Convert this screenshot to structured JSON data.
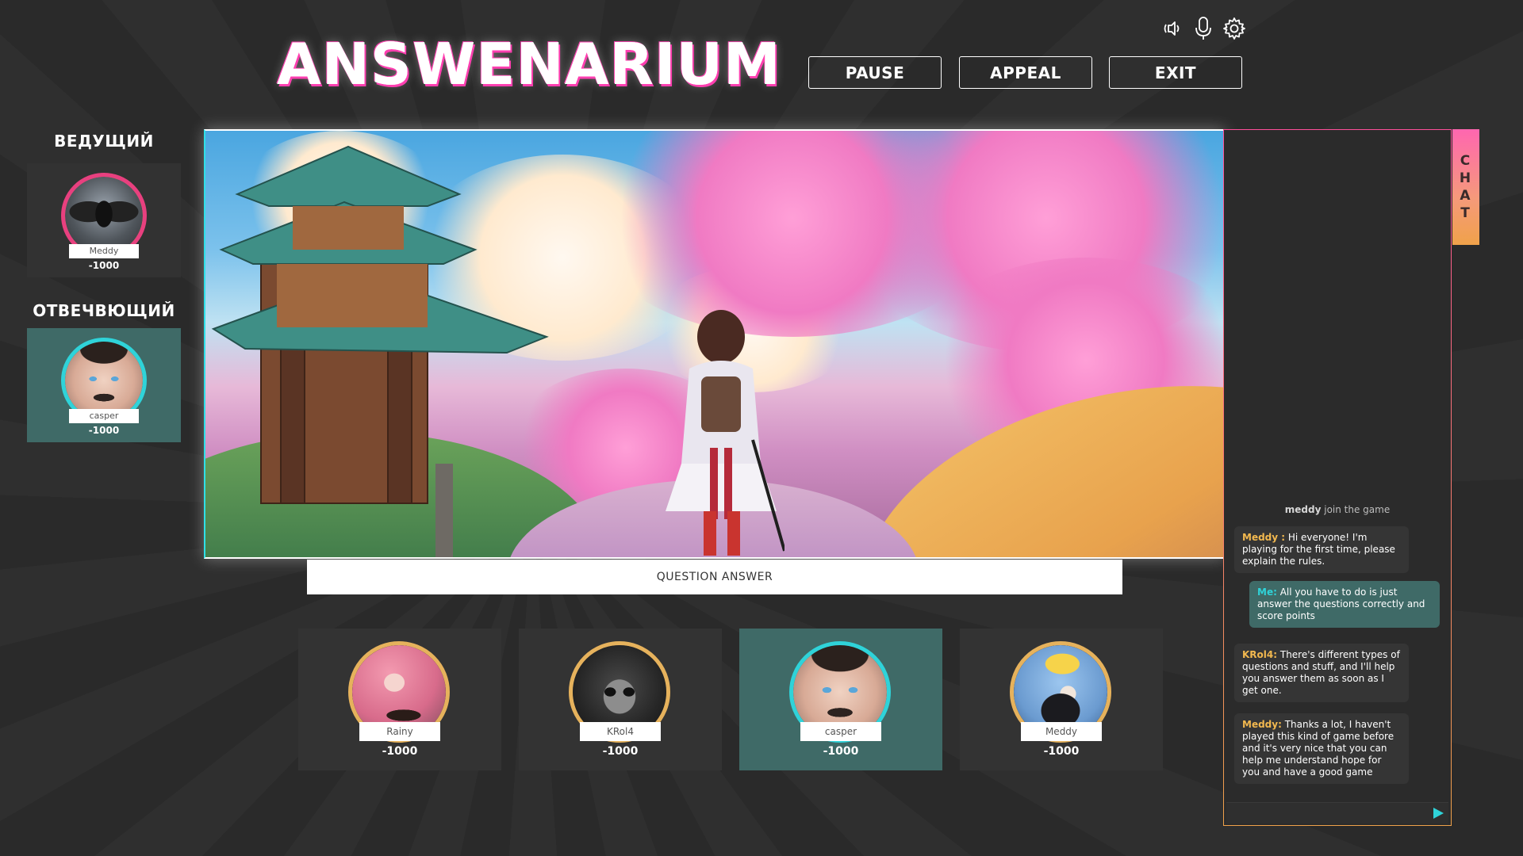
{
  "app": {
    "logo_text": "ANSWENARIUM"
  },
  "top_icons": [
    {
      "name": "volume-icon"
    },
    {
      "name": "microphone-icon"
    },
    {
      "name": "gear-icon"
    }
  ],
  "toolbar": {
    "pause_label": "PAUSE",
    "appeal_label": "APPEAL",
    "exit_label": "EXIT"
  },
  "roles": {
    "host_title": "ВЕДУЩИЙ",
    "host": {
      "name": "Meddy",
      "score": "-1000"
    },
    "answerer_title": "ОТВЕЧВЮЩИЙ",
    "answerer": {
      "name": "casper",
      "score": "-1000"
    }
  },
  "question": {
    "caption": "QUESTION ANSWER"
  },
  "players": [
    {
      "name": "Rainy",
      "score": "-1000",
      "active": false
    },
    {
      "name": "KRol4",
      "score": "-1000",
      "active": false
    },
    {
      "name": "casper",
      "score": "-1000",
      "active": true
    },
    {
      "name": "Meddy",
      "score": "-1000",
      "active": false
    }
  ],
  "chat": {
    "tab_letters": [
      "C",
      "H",
      "A",
      "T"
    ],
    "system_message": {
      "user": "meddy",
      "text": " join the game"
    },
    "messages": [
      {
        "author": "Meddy :",
        "text": " Hi everyone! I'm playing for the first time, please explain the rules.",
        "self": false
      },
      {
        "author": "Me:",
        "text": " All you have to do is just answer the questions correctly and score points",
        "self": true
      },
      {
        "author": "KRol4:",
        "text": " There's different types of questions and stuff, and I'll help you answer them as soon as I get one.",
        "self": false
      },
      {
        "author": "Meddy:",
        "text": " Thanks a lot, I haven't played this kind of game before and it's very nice that you can help me understand hope for you and have a good game",
        "self": false
      }
    ],
    "input_value": "",
    "input_placeholder": ""
  },
  "colors": {
    "accent_teal": "#2fd3d9",
    "accent_pink": "#ff4f9a",
    "accent_gold": "#e6b25c",
    "active_card": "#3f6a67"
  }
}
